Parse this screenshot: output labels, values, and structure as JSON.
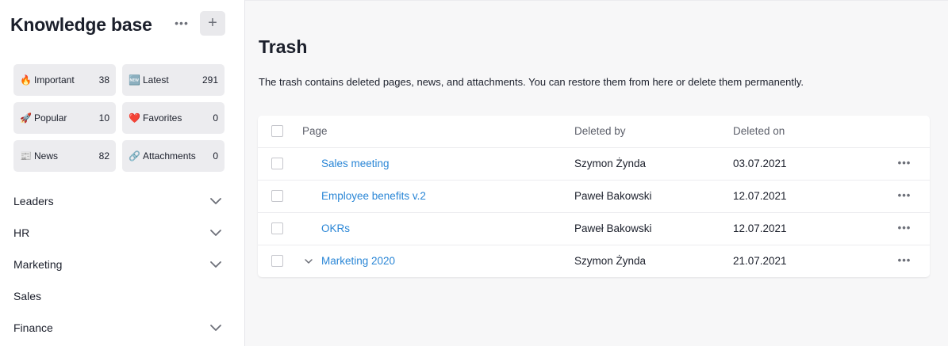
{
  "sidebar": {
    "title": "Knowledge base",
    "more_icon": "more-horizontal-icon",
    "add_label": "+",
    "tiles": [
      {
        "icon": "🔥",
        "label": "Important",
        "count": "38"
      },
      {
        "icon": "🆕",
        "label": "Latest",
        "count": "291"
      },
      {
        "icon": "🚀",
        "label": "Popular",
        "count": "10"
      },
      {
        "icon": "❤️",
        "label": "Favorites",
        "count": "0"
      },
      {
        "icon": "📰",
        "label": "News",
        "count": "82"
      },
      {
        "icon": "🔗",
        "label": "Attachments",
        "count": "0"
      }
    ],
    "sections": [
      {
        "label": "Leaders",
        "expandable": true
      },
      {
        "label": "HR",
        "expandable": true
      },
      {
        "label": "Marketing",
        "expandable": true
      },
      {
        "label": "Sales",
        "expandable": false
      },
      {
        "label": "Finance",
        "expandable": true
      }
    ]
  },
  "main": {
    "title": "Trash",
    "description": "The trash contains deleted pages, news, and attachments. You can restore them from here or delete them permanently.",
    "table": {
      "headers": {
        "page": "Page",
        "deleted_by": "Deleted by",
        "deleted_on": "Deleted on"
      },
      "rows": [
        {
          "page": "Sales meeting",
          "deleted_by": "Szymon Żynda",
          "deleted_on": "03.07.2021",
          "expandable": false
        },
        {
          "page": "Employee benefits v.2",
          "deleted_by": "Paweł Bakowski",
          "deleted_on": "12.07.2021",
          "expandable": false
        },
        {
          "page": "OKRs",
          "deleted_by": "Paweł Bakowski",
          "deleted_on": "12.07.2021",
          "expandable": false
        },
        {
          "page": "Marketing 2020",
          "deleted_by": "Szymon Żynda",
          "deleted_on": "21.07.2021",
          "expandable": true
        }
      ],
      "row_more_icon": "more-horizontal-icon"
    }
  },
  "colors": {
    "link": "#2a86d6",
    "tile_bg": "#ececef",
    "page_bg": "#f7f7f8"
  }
}
